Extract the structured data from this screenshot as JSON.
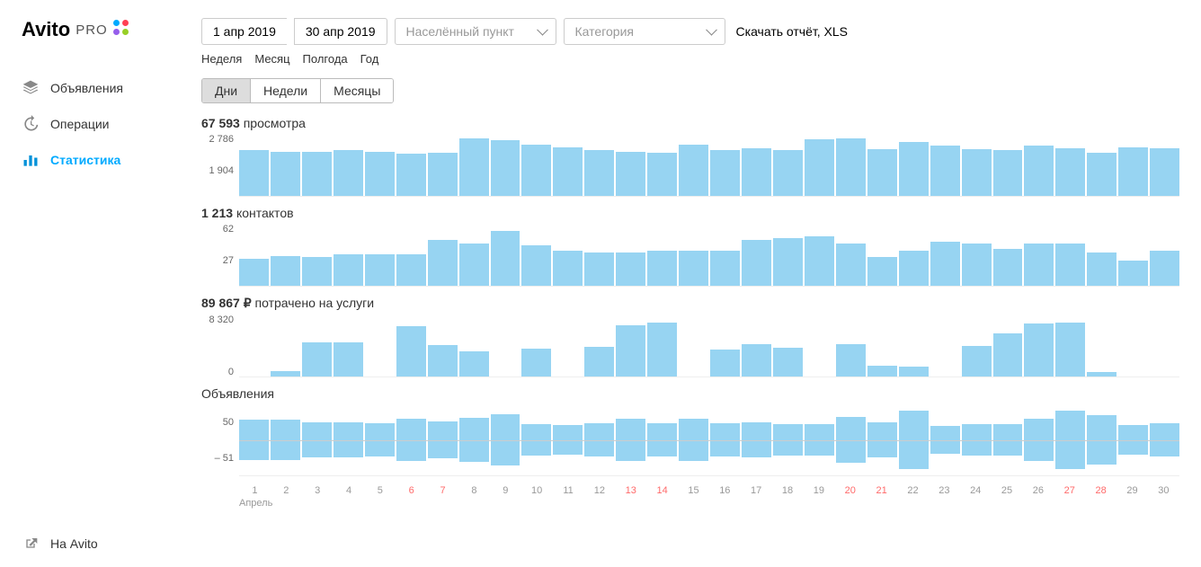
{
  "logo": {
    "main": "Avito",
    "pro": "PRO"
  },
  "sidebar": {
    "items": [
      {
        "label": "Объявления",
        "icon": "layers",
        "active": false
      },
      {
        "label": "Операции",
        "icon": "history",
        "active": false
      },
      {
        "label": "Статистика",
        "icon": "bars",
        "active": true
      }
    ],
    "footer": {
      "label": "На Avito"
    }
  },
  "filters": {
    "date_from": "1 апр 2019",
    "date_to": "30 апр 2019",
    "city_placeholder": "Населённый пункт",
    "category_placeholder": "Категория",
    "download": "Скачать отчёт, XLS"
  },
  "periods": [
    "Неделя",
    "Месяц",
    "Полгода",
    "Год"
  ],
  "granularity": {
    "options": [
      "Дни",
      "Недели",
      "Месяцы"
    ],
    "active": 0
  },
  "charts": {
    "views": {
      "total": "67 593",
      "unit": "просмотра",
      "yticks": [
        "2 786",
        "1 904"
      ]
    },
    "contacts": {
      "total": "1 213",
      "unit": "контактов",
      "yticks": [
        "62",
        "27"
      ]
    },
    "spend": {
      "total": "89 867 ₽",
      "unit": "потрачено на услуги",
      "yticks": [
        "8 320",
        "0"
      ]
    },
    "ads": {
      "title": "Объявления",
      "yticks": [
        "50",
        "– 51"
      ]
    }
  },
  "x_axis": {
    "days": [
      1,
      2,
      3,
      4,
      5,
      6,
      7,
      8,
      9,
      10,
      11,
      12,
      13,
      14,
      15,
      16,
      17,
      18,
      19,
      20,
      21,
      22,
      23,
      24,
      25,
      26,
      27,
      28,
      29,
      30
    ],
    "weekends": [
      6,
      7,
      13,
      14,
      20,
      21,
      27,
      28
    ],
    "month": "Апрель"
  },
  "chart_data": [
    {
      "type": "bar",
      "title": "67 593 просмотра",
      "ylim": [
        0,
        3000
      ],
      "categories": [
        1,
        2,
        3,
        4,
        5,
        6,
        7,
        8,
        9,
        10,
        11,
        12,
        13,
        14,
        15,
        16,
        17,
        18,
        19,
        20,
        21,
        22,
        23,
        24,
        25,
        26,
        27,
        28,
        29,
        30
      ],
      "values": [
        2200,
        2150,
        2150,
        2200,
        2150,
        2050,
        2100,
        2786,
        2700,
        2500,
        2350,
        2200,
        2150,
        2100,
        2500,
        2200,
        2300,
        2200,
        2750,
        2800,
        2250,
        2600,
        2450,
        2250,
        2200,
        2450,
        2300,
        2100,
        2350,
        2300
      ]
    },
    {
      "type": "bar",
      "title": "1 213 контактов",
      "ylim": [
        0,
        70
      ],
      "categories": [
        1,
        2,
        3,
        4,
        5,
        6,
        7,
        8,
        9,
        10,
        11,
        12,
        13,
        14,
        15,
        16,
        17,
        18,
        19,
        20,
        21,
        22,
        23,
        24,
        25,
        26,
        27,
        28,
        29,
        30
      ],
      "values": [
        30,
        34,
        32,
        36,
        36,
        36,
        52,
        48,
        62,
        46,
        40,
        38,
        38,
        40,
        40,
        40,
        52,
        54,
        56,
        48,
        32,
        40,
        50,
        48,
        42,
        48,
        48,
        38,
        28,
        40
      ]
    },
    {
      "type": "bar",
      "title": "89 867 ₽ потрачено на услуги",
      "ylim": [
        0,
        10000
      ],
      "categories": [
        1,
        2,
        3,
        4,
        5,
        6,
        7,
        8,
        9,
        10,
        11,
        12,
        13,
        14,
        15,
        16,
        17,
        18,
        19,
        20,
        21,
        22,
        23,
        24,
        25,
        26,
        27,
        28,
        29,
        30
      ],
      "values": [
        0,
        900,
        5500,
        5500,
        0,
        8100,
        5100,
        4000,
        0,
        4500,
        0,
        4800,
        8300,
        8700,
        0,
        4300,
        5200,
        4600,
        0,
        5200,
        1800,
        1600,
        0,
        5000,
        6900,
        8500,
        8700,
        700,
        0,
        0
      ]
    },
    {
      "type": "bar-diverging",
      "title": "Объявления",
      "ylim": [
        -60,
        60
      ],
      "categories": [
        1,
        2,
        3,
        4,
        5,
        6,
        7,
        8,
        9,
        10,
        11,
        12,
        13,
        14,
        15,
        16,
        17,
        18,
        19,
        20,
        21,
        22,
        23,
        24,
        25,
        26,
        27,
        28,
        29,
        30
      ],
      "series": [
        {
          "name": "up",
          "values": [
            28,
            30,
            20,
            28,
            25,
            30,
            28,
            50,
            45,
            32,
            25,
            30,
            28,
            30,
            30,
            25,
            30,
            28,
            28,
            30,
            20,
            50,
            30,
            28,
            30,
            50,
            48,
            42,
            30,
            40
          ]
        },
        {
          "name": "down",
          "values": [
            -40,
            -38,
            -40,
            -32,
            -30,
            -42,
            -35,
            -25,
            -42,
            -20,
            -25,
            -25,
            -42,
            -25,
            -42,
            -30,
            -30,
            -24,
            -26,
            -48,
            -38,
            -50,
            -18,
            -25,
            -22,
            -22,
            -50,
            -42,
            -20,
            -15
          ]
        }
      ]
    }
  ]
}
